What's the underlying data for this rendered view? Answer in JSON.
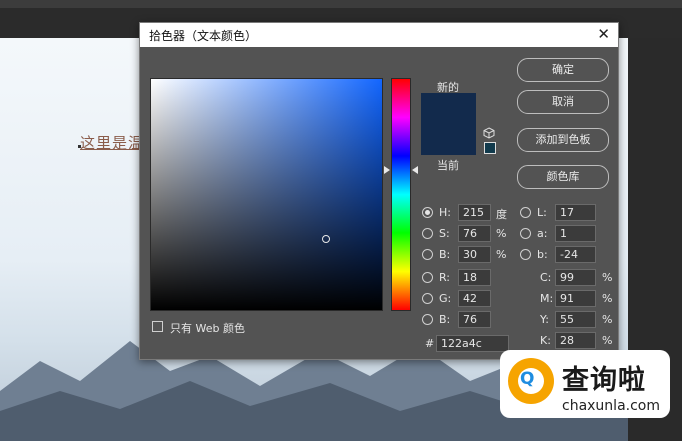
{
  "background": {
    "doc_text": "这里是温"
  },
  "dialog": {
    "title": "拾色器（文本颜色）",
    "close_glyph": "✕",
    "labels": {
      "new": "新的",
      "current": "当前"
    },
    "buttons": {
      "ok": "确定",
      "cancel": "取消",
      "add_to_swatches": "添加到色板",
      "color_libraries": "颜色库"
    },
    "hsb": {
      "h": {
        "label": "H:",
        "value": "215",
        "unit": "度",
        "selected": true
      },
      "s": {
        "label": "S:",
        "value": "76",
        "unit": "%"
      },
      "b": {
        "label": "B:",
        "value": "30",
        "unit": "%"
      }
    },
    "rgb": {
      "r": {
        "label": "R:",
        "value": "18"
      },
      "g": {
        "label": "G:",
        "value": "42"
      },
      "b": {
        "label": "B:",
        "value": "76"
      }
    },
    "lab": {
      "l": {
        "label": "L:",
        "value": "17"
      },
      "a": {
        "label": "a:",
        "value": "1"
      },
      "b": {
        "label": "b:",
        "value": "-24"
      }
    },
    "cmyk": {
      "c": {
        "label": "C:",
        "value": "99",
        "unit": "%"
      },
      "m": {
        "label": "M:",
        "value": "91",
        "unit": "%"
      },
      "y": {
        "label": "Y:",
        "value": "55",
        "unit": "%"
      },
      "k": {
        "label": "K:",
        "value": "28",
        "unit": "%"
      }
    },
    "hex": {
      "label": "#",
      "value": "122a4c"
    },
    "web_only": {
      "label": "只有 Web 颜色",
      "checked": false
    },
    "colors": {
      "selected": "#122a4c",
      "dialog_bg": "#535353"
    }
  },
  "watermark": {
    "logo_letter": "Q",
    "title": "查询啦",
    "subtitle": "chaxunla.com"
  }
}
